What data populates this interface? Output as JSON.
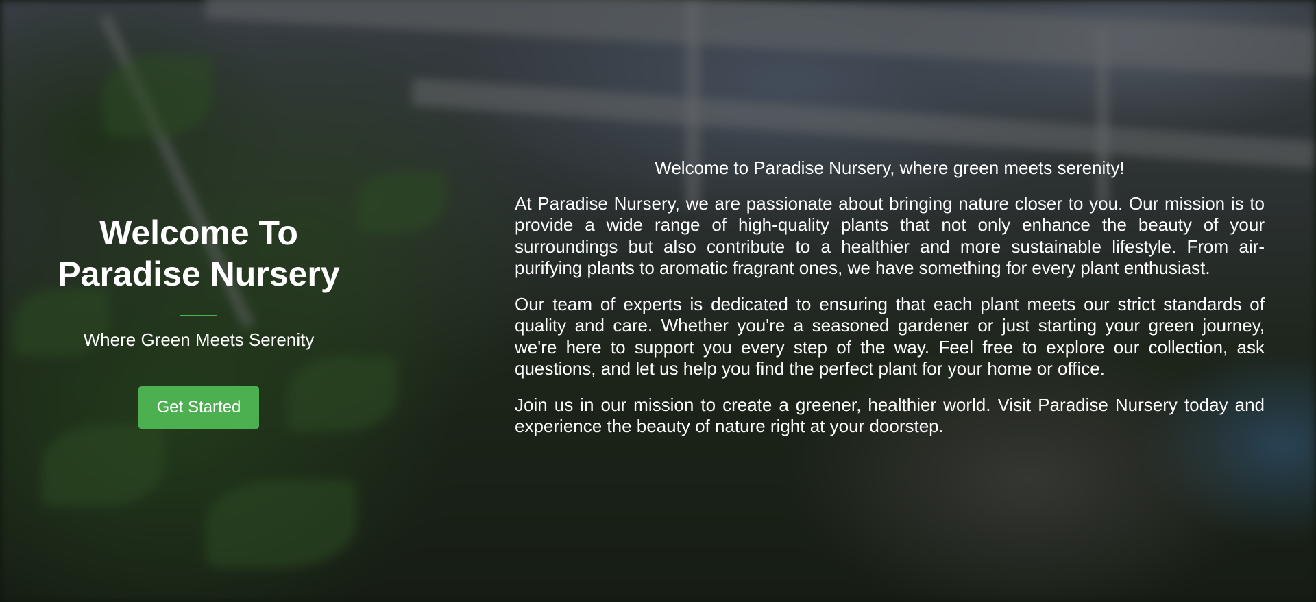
{
  "hero": {
    "title_line1": "Welcome To",
    "title_line2": "Paradise Nursery",
    "subtitle": "Where Green Meets Serenity",
    "cta_label": "Get Started"
  },
  "about": {
    "intro": "Welcome to Paradise Nursery, where green meets serenity!",
    "paragraphs": [
      "At Paradise Nursery, we are passionate about bringing nature closer to you. Our mission is to provide a wide range of high-quality plants that not only enhance the beauty of your surroundings but also contribute to a healthier and more sustainable lifestyle. From air-purifying plants to aromatic fragrant ones, we have something for every plant enthusiast.",
      "Our team of experts is dedicated to ensuring that each plant meets our strict standards of quality and care. Whether you're a seasoned gardener or just starting your green journey, we're here to support you every step of the way. Feel free to explore our collection, ask questions, and let us help you find the perfect plant for your home or office.",
      "Join us in our mission to create a greener, healthier world. Visit Paradise Nursery today and experience the beauty of nature right at your doorstep."
    ]
  },
  "colors": {
    "accent": "#4caf50",
    "text": "#ffffff",
    "overlay": "rgba(0,0,0,0.5)"
  }
}
